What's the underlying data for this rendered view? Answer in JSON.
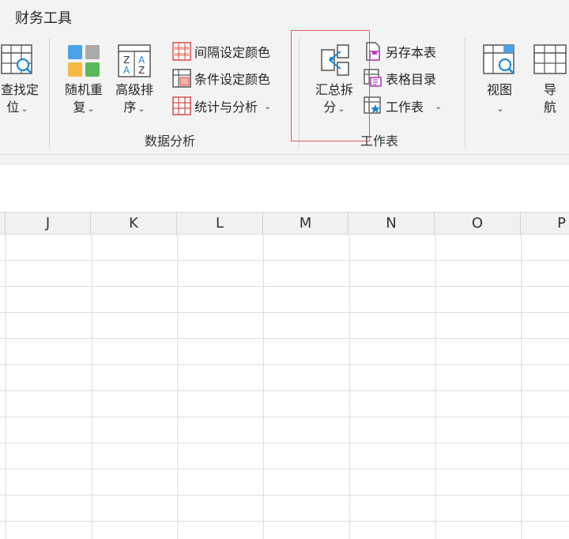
{
  "ribbon": {
    "tab_title": "财务工具",
    "left_partial": {
      "line1": "查找定",
      "line2": "位"
    },
    "shuffle": {
      "line1": "随机重",
      "line2": "复"
    },
    "adv_sort": {
      "line1": "高级排",
      "line2": "序"
    },
    "interval_color": "间隔设定颜色",
    "condition_color": "条件设定颜色",
    "stats_analysis": "统计与分析",
    "group_data_analysis": "数据分析",
    "summary_split": {
      "line1": "汇总拆",
      "line2": "分"
    },
    "save_as_sheet": "另存本表",
    "sheet_directory": "表格目录",
    "worksheet": "工作表",
    "group_worksheet": "工作表",
    "view": {
      "line1": "视图"
    },
    "nav_partial": {
      "line1": "导",
      "line2": "航"
    },
    "chevron": "⌄"
  },
  "sheet": {
    "columns": [
      "J",
      "K",
      "L",
      "M",
      "N",
      "O",
      "P"
    ]
  },
  "colors": {
    "highlight_border": "#e25a5a",
    "ribbon_bg": "#f3f3f3",
    "grid_line": "#dddddd"
  }
}
